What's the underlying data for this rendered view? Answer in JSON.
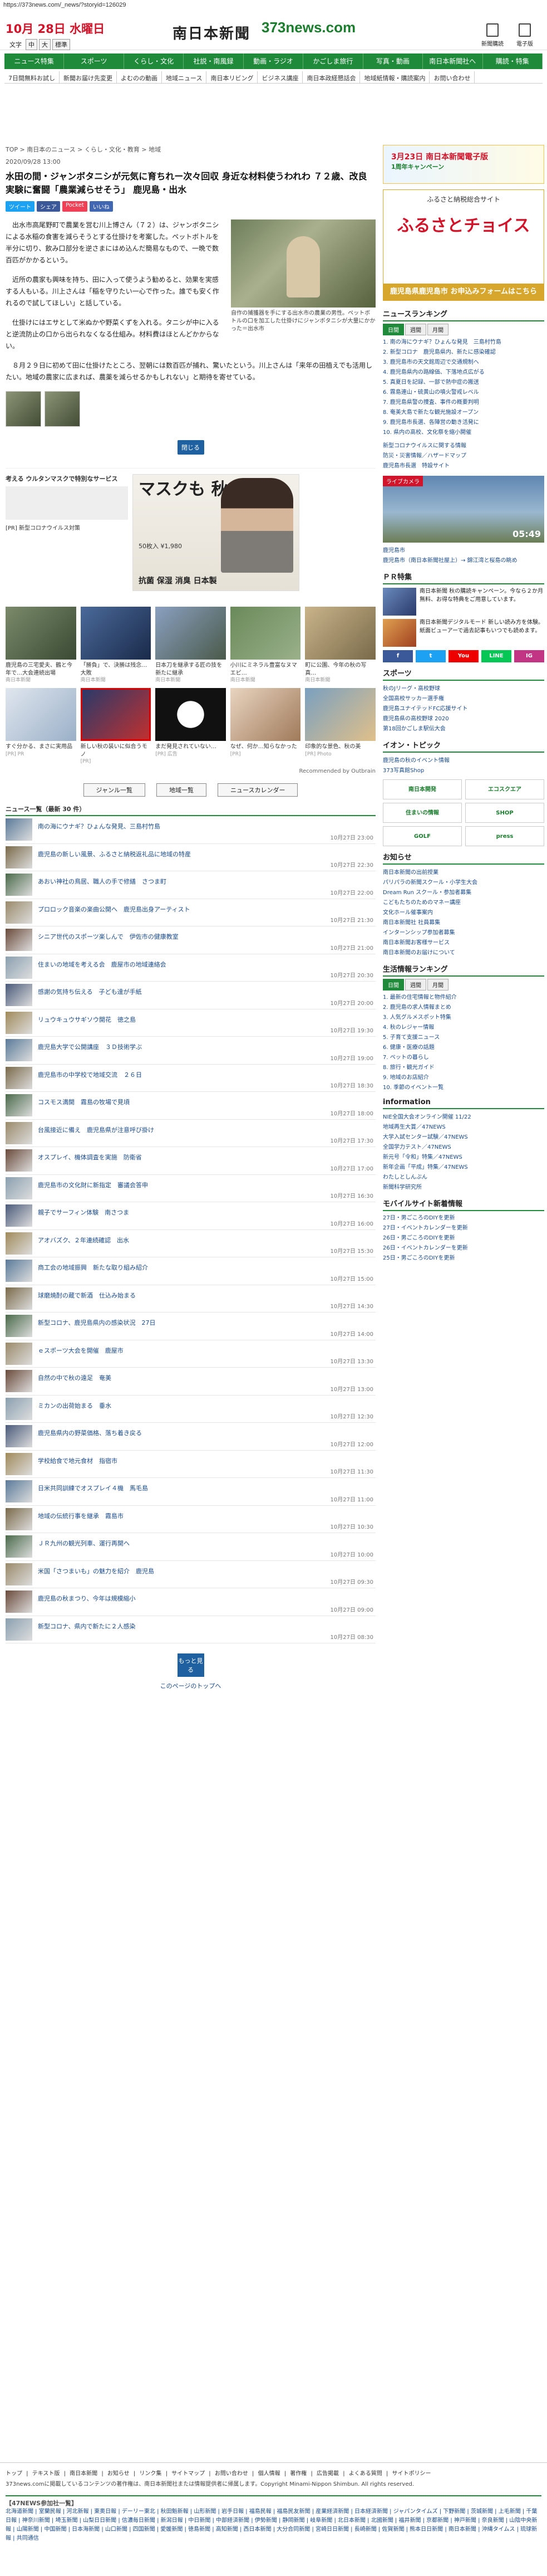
{
  "url": "https://373news.com/_news/?storyid=126029",
  "header": {
    "date": "10月 28日 水曜日",
    "text_size_label": "文字",
    "text_sizes": [
      "中",
      "大",
      "標準"
    ],
    "logo_main": "南日本新聞",
    "logo_site": "373news.com",
    "top_links": [
      "新聞購読",
      "電子版"
    ]
  },
  "gnav": [
    "ニュース特集",
    "スポーツ",
    "くらし・文化",
    "社説・南風録",
    "動画・ラジオ",
    "かごしま旅行",
    "写真・動画",
    "南日本新聞社へ",
    "購読・特集"
  ],
  "snav": [
    "7日間無料お試し",
    "新聞お届け先変更",
    "よむのの動画",
    "地域ニュース",
    "南日本リビング",
    "ビジネス講座",
    "南日本政経懇話会",
    "地域紙情報・購読案内",
    "お問い合わせ"
  ],
  "breadcrumb": "TOP > 南日本のニュース > くらし・文化・教育 > 地域",
  "article": {
    "pubdate": "2020/09/28 13:00",
    "title": "水田の間・ジャンボタニシが元気に育ちれー次々回収 身近な材料使うわれわ ７２歳、改良実験に奮闘「農業減らせそう」 鹿児島・出水",
    "share": [
      "ツイート",
      "シェア",
      "Pocket",
      "いいね"
    ],
    "fig_caption": "自作の捕獲器を手にする出水市の農業の男性。ペットボトルの口を加工した仕掛けにジャンボタニシが大量にかかった＝出水市",
    "paragraphs": [
      "出水市高尾野町で農業を営む川上博さん（７２）は、ジャンボタニシによる水稲の食害を減らそうとする仕掛けを考案した。ペットボトルを半分に切り、飲み口部分を逆さまにはめ込んだ簡易なもので、一晩で数百匹がかかるという。",
      "近所の農家も興味を持ち、田に入って使うよう勧めると、効果を実感する人もいる。川上さんは「稲を守りたい一心で作った。誰でも安く作れるので試してほしい」と話している。",
      "仕掛けにはエサとして米ぬかや野菜くずを入れる。タニシが中に入ると逆流防止の口から出られなくなる仕組み。材料費はほとんどかからない。",
      "８月２９日に初めて田に仕掛けたところ、翌朝には数百匹が捕れ、驚いたという。川上さんは「来年の田植えでも活用したい。地域の農家に広まれば、農薬を減らせるかもしれない」と期待を寄せている。"
    ],
    "close_label": "閉じる"
  },
  "ad": {
    "headline": "考える ウルタンマスクで特別なサービス",
    "sub": "[PR] 新型コロナウイルス対策",
    "mask_text": "マスクも 秋の装い",
    "tags": "抗菌 保湿 消臭 日本製",
    "price": "50枚入 ¥1,980"
  },
  "recommend": [
    {
      "text": "鹿児島の三宅愛夫、鶴と今年で…大会連続出場",
      "src": "南日本新聞"
    },
    {
      "text": "「勝負」で、決勝は残念…大敗",
      "src": "南日本新聞"
    },
    {
      "text": "日本刀を継承する匠の技を新たに継承",
      "src": "南日本新聞"
    },
    {
      "text": "小川にミネラル豊富なヌマエビ…",
      "src": "南日本新聞"
    },
    {
      "text": "町に公園、今年の秋の写真…",
      "src": "南日本新聞"
    },
    {
      "text": "すぐ分かる、まさに実用品",
      "src": "[PR] PR"
    },
    {
      "text": "新しい秋の装いに似合うモノ",
      "src": "[PR]"
    },
    {
      "text": "まだ発見されていない…",
      "src": "[PR] 広告"
    },
    {
      "text": "なぜ、何か…知らなかった",
      "src": "[PR]"
    },
    {
      "text": "印象的な景色、秋の美",
      "src": "[PR] Photo"
    }
  ],
  "outbrain": "Recommended by Outbrain",
  "tabs": [
    "ジャンル一覧",
    "地域一覧",
    "ニュースカレンダー"
  ],
  "list_header": "ニュース一覧（最新 30 件）",
  "list": [
    {
      "title": "南の海にウナギ？ひょんな発見、三島村竹島",
      "time": "10月27日 23:00"
    },
    {
      "title": "鹿児島の新しい風景、ふるさと納税返礼品に地域の特産",
      "time": "10月27日 22:30"
    },
    {
      "title": "あおい神社の鳥居、職人の手で修繕　さつま町",
      "time": "10月27日 22:00"
    },
    {
      "title": "プロロック音楽の楽曲公開へ　鹿児島出身アーティスト",
      "time": "10月27日 21:30"
    },
    {
      "title": "シニア世代のスポーツ楽しんで　伊佐市の健康教室",
      "time": "10月27日 21:00"
    },
    {
      "title": "住まいの地域を考える会　鹿屋市の地域連絡会",
      "time": "10月27日 20:30"
    },
    {
      "title": "感謝の気持ち伝える　子ども達が手紙",
      "time": "10月27日 20:00"
    },
    {
      "title": "リュウキュウサギソウ開花　徳之島",
      "time": "10月27日 19:30"
    },
    {
      "title": "鹿児島大学で公開講座　３Ｄ技術学ぶ",
      "time": "10月27日 19:00"
    },
    {
      "title": "鹿児島市の中学校で地域交流　２６日",
      "time": "10月27日 18:30"
    },
    {
      "title": "コスモス満開　霧島の牧場で見頃",
      "time": "10月27日 18:00"
    },
    {
      "title": "台風接近に備え　鹿児島県が注意呼び掛け",
      "time": "10月27日 17:30"
    },
    {
      "title": "オスプレイ、機体調査を実施　防衛省",
      "time": "10月27日 17:00"
    },
    {
      "title": "鹿児島市の文化財に新指定　審議会答申",
      "time": "10月27日 16:30"
    },
    {
      "title": "親子でサーフィン体験　南さつま",
      "time": "10月27日 16:00"
    },
    {
      "title": "アオバズク、２年連続確認　出水",
      "time": "10月27日 15:30"
    },
    {
      "title": "商工会の地域振興　新たな取り組み紹介",
      "time": "10月27日 15:00"
    },
    {
      "title": "球磨焼酎の蔵で新酒　仕込み始まる",
      "time": "10月27日 14:30"
    },
    {
      "title": "新型コロナ、鹿児島県内の感染状況　27日",
      "time": "10月27日 14:00"
    },
    {
      "title": "ｅスポーツ大会を開催　鹿屋市",
      "time": "10月27日 13:30"
    },
    {
      "title": "自然の中で秋の遠足　奄美",
      "time": "10月27日 13:00"
    },
    {
      "title": "ミカンの出荷始まる　垂水",
      "time": "10月27日 12:30"
    },
    {
      "title": "鹿児島県内の野菜価格、落ち着き戻る",
      "time": "10月27日 12:00"
    },
    {
      "title": "学校給食で地元食材　指宿市",
      "time": "10月27日 11:30"
    },
    {
      "title": "日米共同訓練でオスプレイ４機　馬毛島",
      "time": "10月27日 11:00"
    },
    {
      "title": "地域の伝統行事を継承　霧島市",
      "time": "10月27日 10:30"
    },
    {
      "title": "ＪＲ九州の観光列車、運行再開へ",
      "time": "10月27日 10:00"
    },
    {
      "title": "米国「さつまいも」の魅力を紹介　鹿児島",
      "time": "10月27日 09:30"
    },
    {
      "title": "鹿児島の秋まつり、今年は規模縮小",
      "time": "10月27日 09:00"
    },
    {
      "title": "新型コロナ、県内で新たに２人感染",
      "time": "10月27日 08:30"
    }
  ],
  "more_label": "もっと見る",
  "pagetop": "このページのトップへ",
  "footer": {
    "links": "トップ | テキスト版 | 南日本新聞 | お知らせ | リンク集 | サイトマップ | お問い合わせ | 個人情報 | 著作権 | 広告掲載 | よくある質問 | サイトポリシー",
    "copy": "373news.comに掲載しているコンテンツの著作権は、南日本新聞社または情報提供者に帰属します。Copyright Minami-Nippon Shimbun. All rights reserved.",
    "group_title": "【47NEWS参加社一覧】",
    "group_text": "北海道新聞 | 室蘭民報 | 河北新報 | 東奥日報 | デーリー東北 | 秋田魁新報 | 山形新聞 | 岩手日報 | 福島民報 | 福島民友新聞 | 産業経済新聞 | 日本経済新聞 | ジャパンタイムズ | 下野新聞 | 茨城新聞 | 上毛新聞 | 千葉日報 | 神奈川新聞 | 埼玉新聞 | 山梨日日新聞 | 信濃毎日新聞 | 新潟日報 | 中日新聞 | 中部経済新聞 | 伊勢新聞 | 静岡新聞 | 岐阜新聞 | 北日本新聞 | 北國新聞 | 福井新聞 | 京都新聞 | 神戸新聞 | 奈良新聞 | 山陰中央新報 | 山陽新聞 | 中国新聞 | 日本海新聞 | 山口新聞 | 四国新聞 | 愛媛新聞 | 徳島新聞 | 高知新聞 | 西日本新聞 | 大分合同新聞 | 宮崎日日新聞 | 長崎新聞 | 佐賀新聞 | 熊本日日新聞 | 南日本新聞 | 沖縄タイムス | 琉球新報 | 共同通信"
  },
  "sidebar": {
    "banner_title": "3月23日 南日本新聞電子版",
    "banner_sub": "1周年キャンペーン",
    "furusato_top": "ふるさと納税総合サイト",
    "furusato_name": "ふるさとチョイス",
    "furusato_bottom": "鹿児島県鹿児島市 お申込みフォームはこちら",
    "ranking_title": "ニュースランキング",
    "ranking_tabs": [
      "日間",
      "週間",
      "月間"
    ],
    "ranking": [
      "1. 南の海にウナギ？ひょんな発見　三島村竹島",
      "2. 新型コロナ　鹿児島県内、新たに感染確認",
      "3. 鹿児島市の天文館周辺で交通規制へ",
      "4. 鹿児島県内の路線価、下落地点広がる",
      "5. 真夏日を記録、一部で熱中症の搬送",
      "6. 霧島連山・硫黄山の噴火警戒レベル",
      "7. 鹿児島県警の捜査、事件の概要判明",
      "8. 奄美大島で新たな観光施設オープン",
      "9. 鹿児島市長選、各陣営の動き活発に",
      "10. 県内の高校、文化祭を縮小開催"
    ],
    "links": [
      "新型コロナウイルスに関する情報",
      "防災・災害情報／ハザードマップ",
      "鹿児島市長選　特設サイト"
    ],
    "cam_label": "今日の天気",
    "cam_title": "ライブカメラ",
    "cam_time": "05:49",
    "weather_links": [
      "鹿児島市",
      "鹿児島市（南日本新聞社屋上）→ 錦江湾と桜島の眺め"
    ],
    "pr_title": "ＰＲ特集",
    "pr_items": [
      "南日本新聞 秋の購読キャンペーン。今なら２か月無料、お得な特典をご用意しています。",
      "南日本新聞デジタルモード 新しい読み方を体験。紙面ビューアーで過去記事もいつでも読めます。"
    ],
    "social": [
      "f",
      "t",
      "You",
      "LINE",
      "IG"
    ],
    "sports_title": "スポーツ",
    "sports_links": [
      "秋のJリーグ・高校野球",
      "全国高校サッカー選手権",
      "鹿児島ユナイテッドFC応援サイト",
      "鹿児島県の高校野球 2020",
      "第18回かごしま駅伝大会"
    ],
    "event_title": "イオン・トピック",
    "event_links": [
      "鹿児島の秋のイベント情報",
      "373写真館Shop"
    ],
    "ads": [
      "南日本開発",
      "エコスクエア",
      "住まいの情報",
      "SHOP",
      "GOLF",
      "press"
    ],
    "notice_title": "お知らせ",
    "notice_links": [
      "南日本新聞の出前授業",
      "パリパラの新聞スクール・小学生大会",
      "Dream Run スクール・参加者募集",
      "こどもたちのためのマネー講座",
      "文化ホール催事案内",
      "南日本新聞社 社員募集",
      "インターンシップ参加者募集",
      "南日本新聞お客様サービス",
      "南日本新聞のお届けについて"
    ],
    "life_title": "生活情報ランキング",
    "life_tabs": [
      "日間",
      "週間",
      "月間"
    ],
    "life_rank": [
      "1. 最新の住宅情報と物件紹介",
      "2. 鹿児島の求人情報まとめ",
      "3. 人気グルメスポット特集",
      "4. 秋のレジャー情報",
      "5. 子育て支援ニュース",
      "6. 健康・医療の話題",
      "7. ペットの暮らし",
      "8. 旅行・観光ガイド",
      "9. 地域のお店紹介",
      "10. 季節のイベント一覧"
    ],
    "info_title": "information",
    "info_links": [
      "NIE全国大会オンライン開催 11/22",
      "地域再生大賞／47NEWS",
      "大学入試センター試験／47NEWS",
      "全国学力テスト／47NEWS",
      "新元号「令和」特集／47NEWS",
      "新年企画「平成」特集／47NEWS",
      "わたしとしんぶん",
      "新聞科学研究所"
    ],
    "mobile_title": "モバイルサイト新着情報",
    "mobile_items": [
      "27日・男ごころのDIYを更新",
      "27日・イベントカレンダーを更新",
      "26日・男ごころのDIYを更新",
      "26日・イベントカレンダーを更新",
      "25日・男ごころのDIYを更新"
    ]
  }
}
